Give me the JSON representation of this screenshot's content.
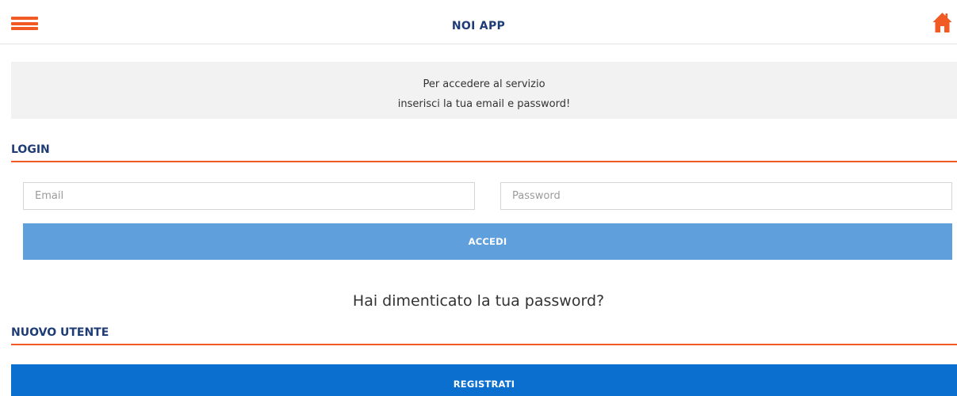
{
  "header": {
    "title": "NOI APP",
    "menu_icon": "hamburger-menu-icon",
    "home_icon": "home-icon"
  },
  "info": {
    "line1": "Per accedere al servizio",
    "line2": "inserisci la tua email e password!"
  },
  "login": {
    "title": "LOGIN",
    "email_placeholder": "Email",
    "email_value": "",
    "password_placeholder": "Password",
    "password_value": "",
    "submit_label": "ACCEDI",
    "forgot_label": "Hai dimenticato la tua password?"
  },
  "signup": {
    "title": "NUOVO UTENTE",
    "button_label": "REGISTRATI"
  },
  "colors": {
    "accent_orange": "#f15a22",
    "title_navy": "#1e3c76",
    "accedi_blue": "#5f9fdc",
    "registrati_blue": "#0a6fce",
    "banner_gray": "#f2f2f2"
  }
}
